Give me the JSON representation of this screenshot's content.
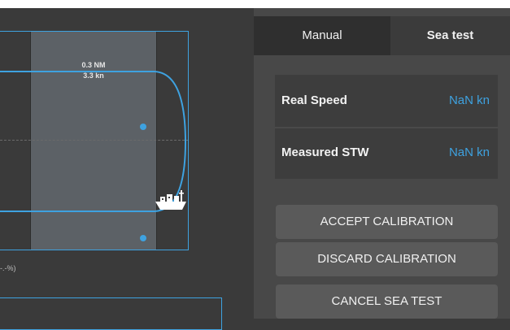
{
  "track": {
    "distance": "0.3 NM",
    "speed": "3.3 kn",
    "percent_label": "-.-%)"
  },
  "tabs": {
    "manual": "Manual",
    "sea_test": "Sea test"
  },
  "readings": {
    "real_speed_label": "Real Speed",
    "real_speed_value": "NaN kn",
    "measured_stw_label": "Measured STW",
    "measured_stw_value": "NaN kn"
  },
  "buttons": {
    "accept": "ACCEPT CALIBRATION",
    "discard": "DISCARD CALIBRATION",
    "cancel": "CANCEL SEA TEST"
  },
  "colors": {
    "accent": "#3ea2e0",
    "panel": "#484848",
    "button": "#5a5a5a"
  }
}
